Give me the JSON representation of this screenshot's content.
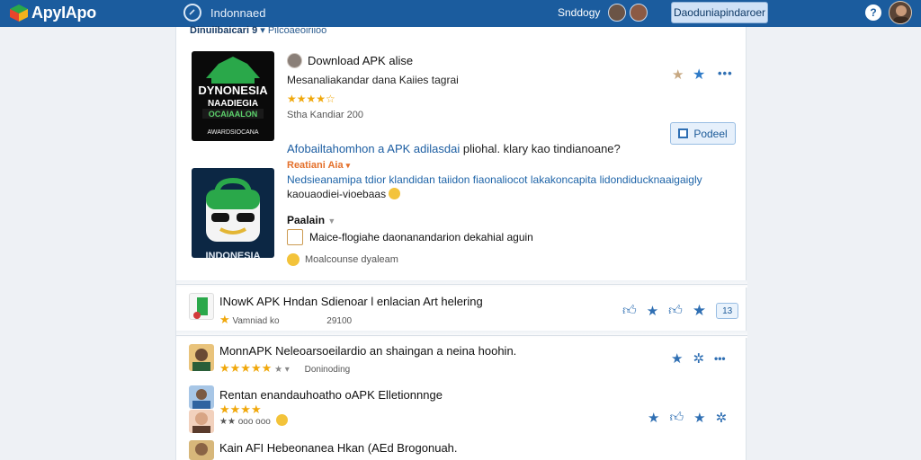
{
  "app": {
    "name": "ApyIApo",
    "logo_icon": "apk-box-icon",
    "accent": "#1b5c9e"
  },
  "header": {
    "search_text": "Indonnaed",
    "link": "Snddogy",
    "button": "Daoduniapindaroer",
    "help_icon": "help-icon"
  },
  "breadcrumb": {
    "left": "Dinuiibaicari 9",
    "right": "Pilcoaeoiriioo"
  },
  "featured": {
    "title": "Download APK alise",
    "subtitle": "Mesanaliakandar dana Kaiies tagrai",
    "rating": "★★★★☆",
    "meta": "Stha Kandiar 200",
    "read_button": "Podeel",
    "question": "Afobailtahomhon a APK adilasdai",
    "question_rest": " pliohal. klary kao tindianoane?",
    "tag": "Reatiani Aia",
    "desc_blue": "Nedsieanamipa tdior klandidan taiidon fiaonaliocot",
    "desc_blue2": " lakakoncapita lidondiducknaaigaigly",
    "desc2": "kaouaodiei-vioebaas",
    "section_label": "Paalain",
    "checkbox_label": "Maice-flogiahe daonanandarion dekahial aguin",
    "note": "Moalcounse dyaleam",
    "logo1_text": {
      "line1": "DYNONESIA",
      "line2": "NAADIEGIA",
      "line3": "OCAIAALON",
      "line4": "AWARDSIOCANA"
    },
    "logo2_text": "INDONESIA"
  },
  "list": [
    {
      "title": "INowK APK Hndan Sdienoar l enlacian Art helering",
      "meta": "Vamniad ko",
      "meta2": "29100",
      "badge": "13"
    },
    {
      "title": "MonnAPK Neleoarsoeilardio an shaingan a neina hoohin.",
      "stars": "★★★★★",
      "meta": "Doninoding"
    },
    {
      "title": "Rentan enandauhoatho oAPK Elletionnnge",
      "stars": "★★★★",
      "meta": "★★  ooo  ooo"
    },
    {
      "title": "Kain AFI Hebeonanea Hkan (AEd Brogonuah."
    }
  ]
}
